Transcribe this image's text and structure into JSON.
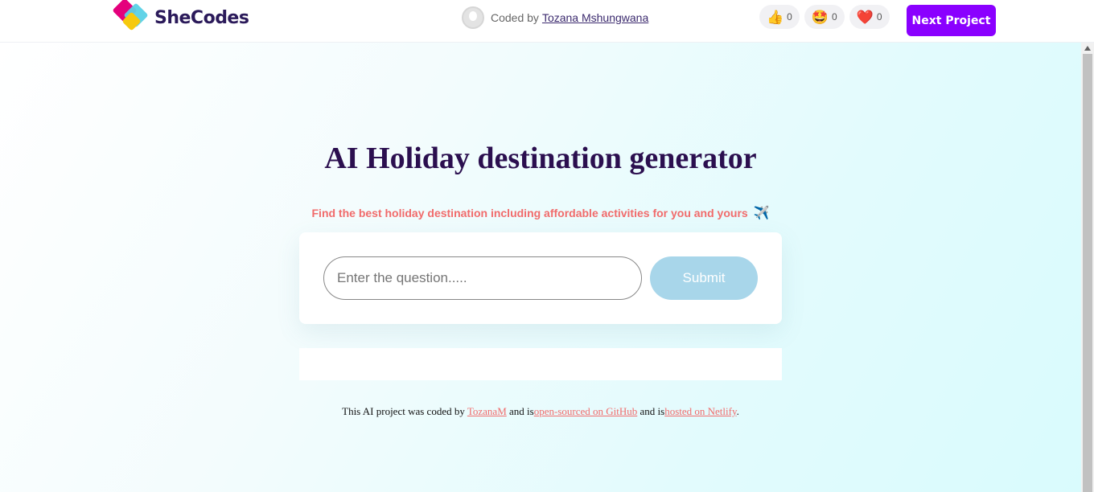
{
  "header": {
    "brand": "SheCodes",
    "coded_by_prefix": "Coded by",
    "author": "Tozana Mshungwana",
    "reactions": [
      {
        "icon": "thumbs-up-icon",
        "glyph": "👍",
        "count": "0"
      },
      {
        "icon": "star-struck-icon",
        "glyph": "🤩",
        "count": "0"
      },
      {
        "icon": "heart-icon",
        "glyph": "❤️",
        "count": "0"
      }
    ],
    "next_label": "Next Project"
  },
  "main": {
    "title": "AI Holiday destination generator",
    "subtitle": "Find the best holiday destination including affordable activities for you and yours",
    "subtitle_emoji": "✈️",
    "input_placeholder": "Enter the question.....",
    "input_value": "",
    "submit_label": "Submit"
  },
  "footer": {
    "prefix": "This AI project was coded by ",
    "author_link": "TozanaM",
    "mid1": " and is",
    "github_link": "open-sourced on GitHub",
    "mid2": " and is",
    "netlify_link": "hosted on Netlify",
    "suffix": "."
  },
  "colors": {
    "accent": "#8a00ff",
    "title": "#2b0f4f",
    "subtitle": "#f16b6b",
    "submit": "#a8d6ea"
  }
}
